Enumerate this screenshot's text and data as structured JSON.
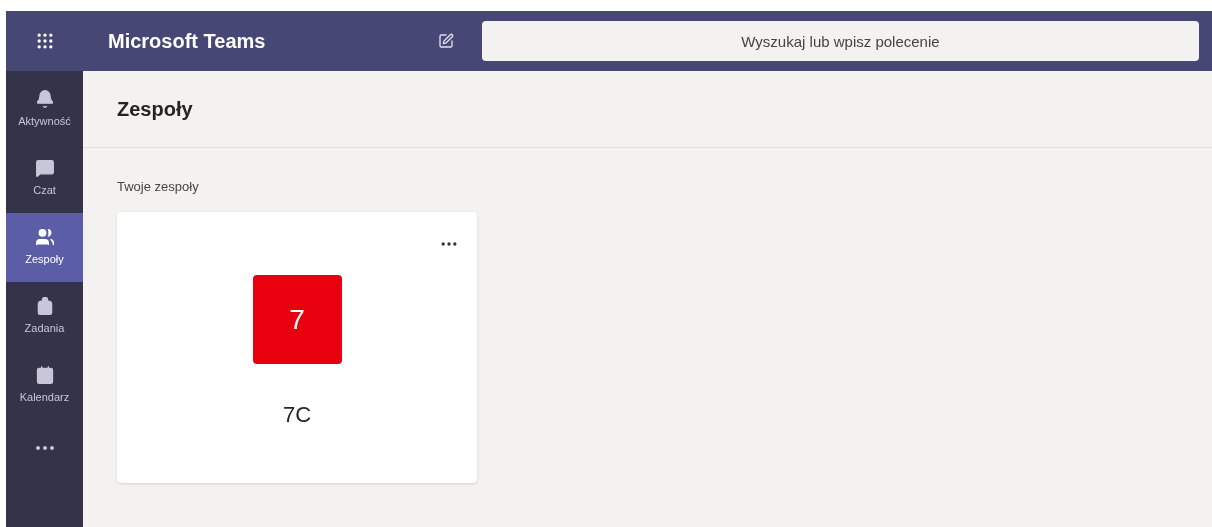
{
  "app": {
    "title": "Microsoft Teams"
  },
  "search": {
    "placeholder": "Wyszukaj lub wpisz polecenie"
  },
  "rail": [
    {
      "kind": "activity",
      "label": "Aktywność",
      "selected": false
    },
    {
      "kind": "chat",
      "label": "Czat",
      "selected": false
    },
    {
      "kind": "teams",
      "label": "Zespoły",
      "selected": true
    },
    {
      "kind": "assignments",
      "label": "Zadania",
      "selected": false
    },
    {
      "kind": "calendar",
      "label": "Kalendarz",
      "selected": false
    },
    {
      "kind": "more"
    }
  ],
  "page": {
    "title": "Zespoły",
    "section": "Twoje zespoły"
  },
  "teams": [
    {
      "avatar": "7",
      "name": "7C",
      "color": "#e8000f"
    }
  ]
}
